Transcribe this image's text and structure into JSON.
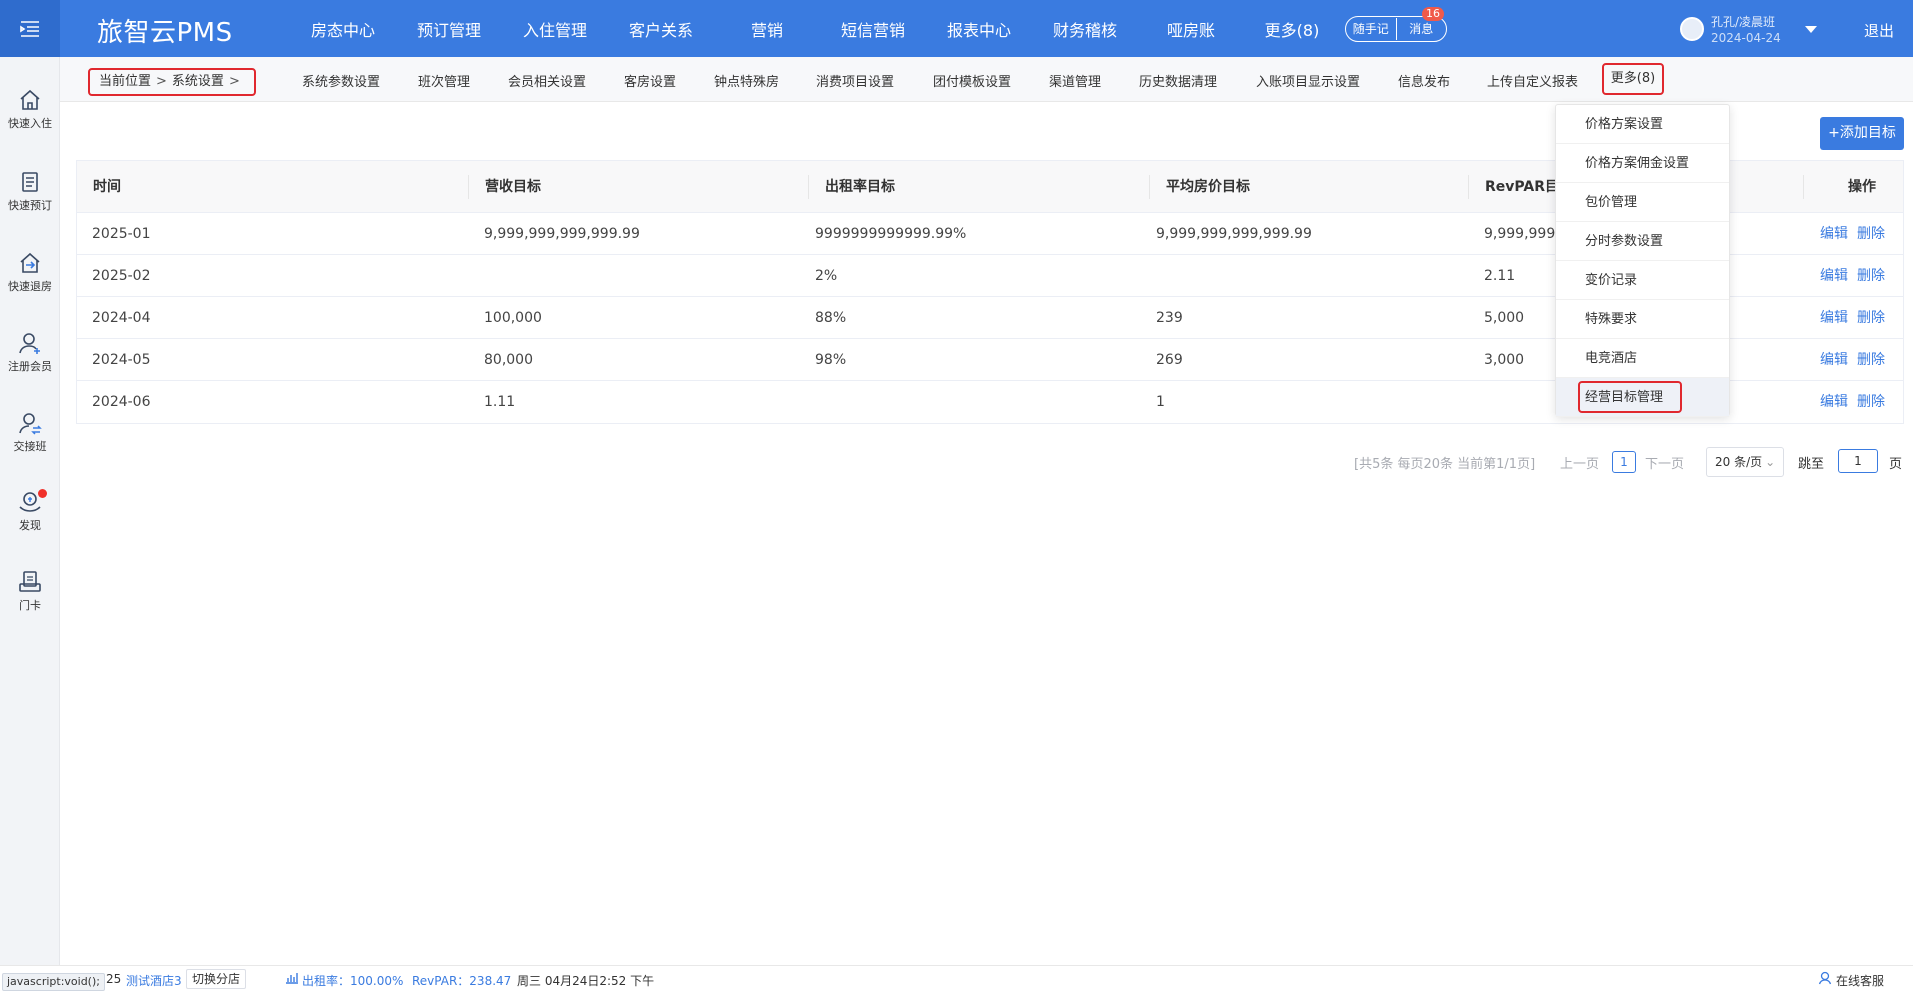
{
  "app": {
    "brand": "旅智云PMS"
  },
  "topnav": {
    "items": [
      "房态中心",
      "预订管理",
      "入住管理",
      "客户关系",
      "营销",
      "短信营销",
      "报表中心",
      "财务稽核",
      "哑房账",
      "更多(8)"
    ],
    "note_label": "随手记",
    "message_label": "消息",
    "message_count": "16",
    "user_name": "孔孔/凌晨班",
    "user_date": "2024-04-24",
    "logout_label": "退出"
  },
  "sidebar": {
    "items": [
      {
        "label": "快速入住",
        "icon": "home-icon"
      },
      {
        "label": "快速预订",
        "icon": "booking-icon"
      },
      {
        "label": "快速退房",
        "icon": "checkout-icon"
      },
      {
        "label": "注册会员",
        "icon": "add-member-icon"
      },
      {
        "label": "交接班",
        "icon": "shift-handover-icon"
      },
      {
        "label": "发现",
        "icon": "discover-icon"
      },
      {
        "label": "门卡",
        "icon": "door-card-icon"
      }
    ]
  },
  "subnav": {
    "breadcrumb_prefix": "当前位置",
    "breadcrumb_sep": ">",
    "breadcrumb_current": "系统设置",
    "items": [
      "系统参数设置",
      "班次管理",
      "会员相关设置",
      "客房设置",
      "钟点特殊房",
      "消费项目设置",
      "团付模板设置",
      "渠道管理",
      "历史数据清理",
      "入账项目显示设置",
      "信息发布",
      "上传自定义报表"
    ],
    "more_label": "更多(8)"
  },
  "toolbar": {
    "add_label": "+添加目标"
  },
  "table": {
    "headers": [
      "时间",
      "营收目标",
      "出租率目标",
      "平均房价目标",
      "RevPAR目",
      "操作"
    ],
    "rows": [
      [
        "2025-01",
        "9,999,999,999,999.99",
        "9999999999999.99%",
        "9,999,999,999,999.99",
        "9,999,999,"
      ],
      [
        "2025-02",
        "",
        "2%",
        "",
        "2.11"
      ],
      [
        "2024-04",
        "100,000",
        "88%",
        "239",
        "5,000"
      ],
      [
        "2024-05",
        "80,000",
        "98%",
        "269",
        "3,000"
      ],
      [
        "2024-06",
        "1.11",
        "",
        "1",
        ""
      ]
    ],
    "edit_label": "编辑",
    "delete_label": "删除"
  },
  "pager": {
    "info": "[共5条 每页20条 当前第1/1页]",
    "prev": "上一页",
    "current": "1",
    "next": "下一页",
    "size": "20 条/页",
    "jump_label": "跳至",
    "jump_value": "1",
    "page_suffix": "页"
  },
  "dropdown": {
    "items": [
      "价格方案设置",
      "价格方案佣金设置",
      "包价管理",
      "分时参数设置",
      "变价记录",
      "特殊要求",
      "电竞酒店",
      "经营目标管理"
    ],
    "active": "经营目标管理"
  },
  "footer": {
    "js_tip": "javascript:void();",
    "num": "25",
    "hotel": "测试酒店3",
    "switch_label": "切换分店",
    "occupancy": "出租率：100.00%",
    "revpar": "RevPAR：238.47",
    "datetime": "周三 04月24日2:52 下午",
    "service": "在线客服"
  },
  "colors": {
    "primary": "#3a7be0",
    "highlight": "#e0282e",
    "badge": "#f05a4a"
  }
}
